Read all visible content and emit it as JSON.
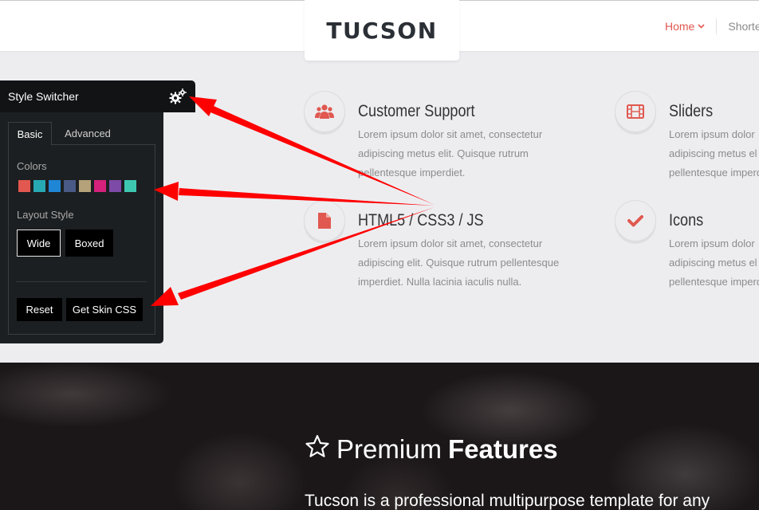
{
  "header": {
    "logo": "TUCSON",
    "nav": {
      "home": "Home",
      "shortcodes": "Shorte"
    }
  },
  "features": [
    {
      "title": "Customer Support",
      "icon": "users-icon",
      "lines": [
        "Lorem ipsum dolor sit amet, consectetur",
        "adipiscing metus elit. Quisque rutrum",
        "pellentesque imperdiet."
      ]
    },
    {
      "title": "Sliders",
      "icon": "film-icon",
      "lines": [
        "Lorem ipsum dolor",
        "adipiscing metus el",
        "pellentesque imperd"
      ]
    },
    {
      "title": "HTML5 / CSS3 / JS",
      "icon": "file-icon",
      "lines": [
        "Lorem ipsum dolor sit amet, consectetur",
        "adipiscing elit. Quisque rutrum pellentesque",
        "imperdiet. Nulla lacinia iaculis nulla."
      ]
    },
    {
      "title": "Icons",
      "icon": "check-icon",
      "lines": [
        "Lorem ipsum dolor",
        "adipiscing metus el",
        "pellentesque imperd"
      ]
    }
  ],
  "premium": {
    "title_light": "Premium",
    "title_bold": "Features",
    "icon": "star-icon",
    "text": "Tucson is a professional multipurpose template for any"
  },
  "style_switcher": {
    "title": "Style Switcher",
    "gear_icon": "gears-icon",
    "tabs": [
      "Basic",
      "Advanced"
    ],
    "colors_label": "Colors",
    "colors": [
      "#e2574f",
      "#27a9b4",
      "#1f86d6",
      "#4a5a86",
      "#b5a27a",
      "#d6217c",
      "#7e4aa8",
      "#3ec7b0"
    ],
    "layout_label": "Layout Style",
    "layout_options": [
      "Wide",
      "Boxed"
    ],
    "reset_label": "Reset",
    "skin_label": "Get Skin CSS"
  },
  "colors": {
    "accent": "#e0584f",
    "arrow": "#ff0000"
  }
}
